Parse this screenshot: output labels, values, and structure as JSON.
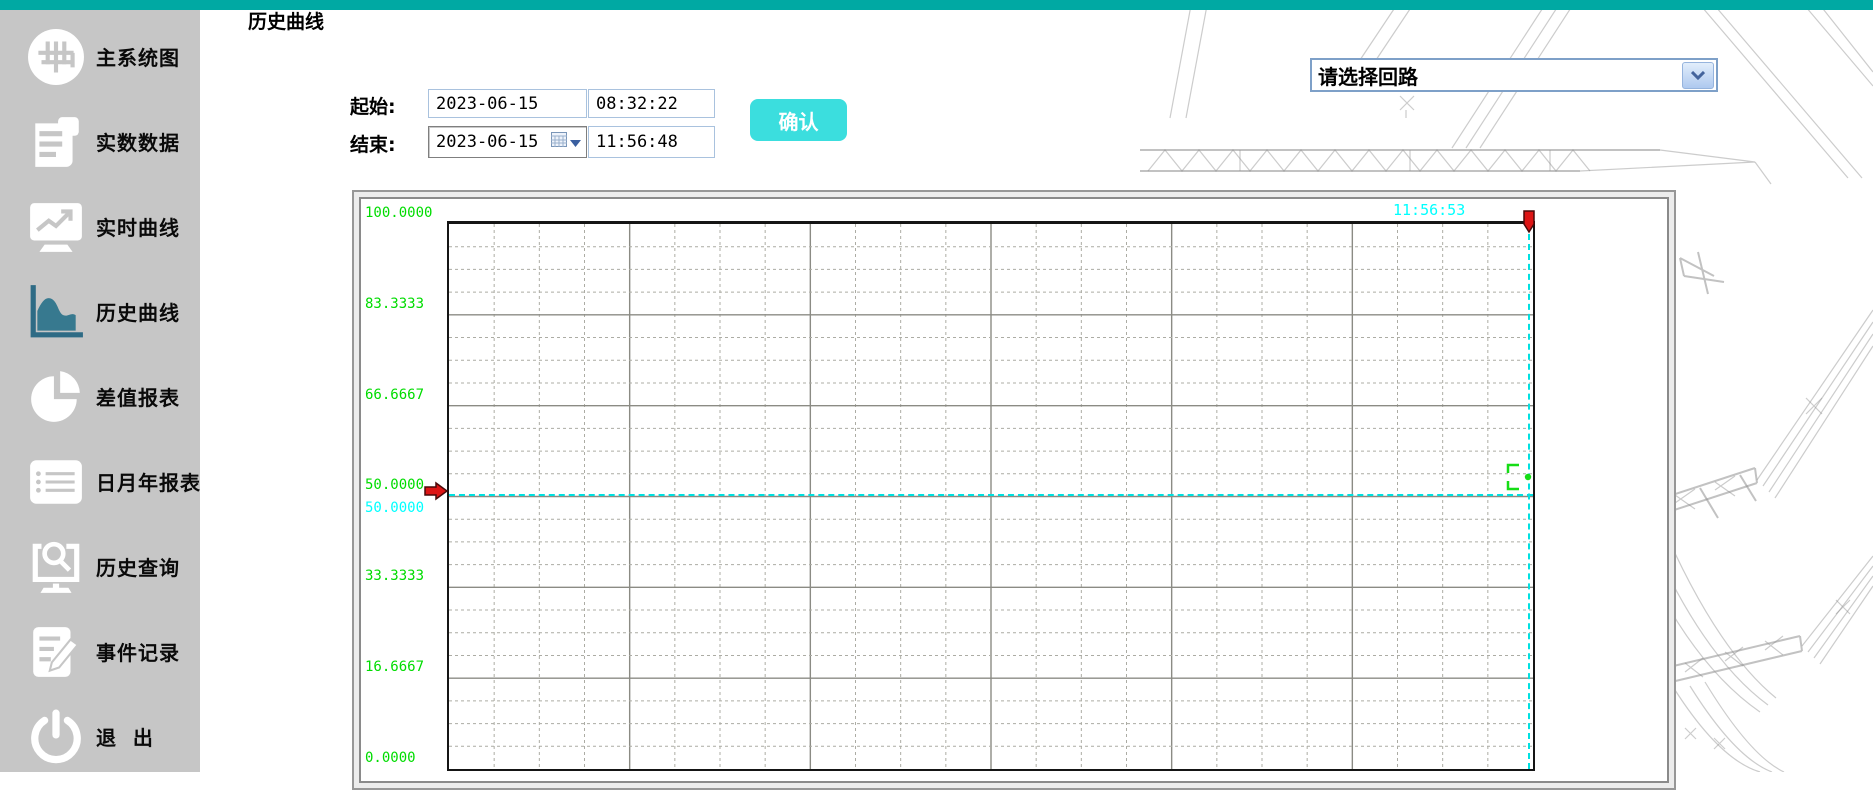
{
  "colors": {
    "accent_teal": "#00A9A3",
    "sidebar_bg": "#C6C6C6",
    "selected_icon_teal": "#37798F",
    "button_cyan": "#3BDEDE",
    "axis_green": "#00DC00",
    "cursor_cyan": "#00E0E0",
    "cyan_text": "#00FFFF",
    "marker_red": "#DD1515",
    "grid_major": "#8B8B84",
    "grid_minor": "#ACACA4",
    "dropdown_border": "#7EA0C8"
  },
  "sidebar": {
    "items": [
      {
        "label": "主系统图",
        "icon": "main-system-icon",
        "selected": false
      },
      {
        "label": "实数数据",
        "icon": "real-data-icon",
        "selected": false
      },
      {
        "label": "实时曲线",
        "icon": "realtime-curve-icon",
        "selected": false
      },
      {
        "label": "历史曲线",
        "icon": "history-curve-icon",
        "selected": true
      },
      {
        "label": "差值报表",
        "icon": "diff-report-icon",
        "selected": false
      },
      {
        "label": "日月年报表",
        "icon": "dmy-report-icon",
        "selected": false
      },
      {
        "label": "历史查询",
        "icon": "history-query-icon",
        "selected": false
      },
      {
        "label": "事件记录",
        "icon": "event-record-icon",
        "selected": false
      },
      {
        "label": "退  出",
        "icon": "exit-icon",
        "selected": false
      }
    ]
  },
  "header": {
    "title": "历史曲线"
  },
  "query": {
    "start_label": "起始:",
    "start_date": "2023-06-15",
    "start_time": "08:32:22",
    "end_label": "结束:",
    "end_date": "2023-06-15",
    "end_time": "11:56:48",
    "confirm_label": "确认"
  },
  "circuit_select": {
    "value": "请选择回路"
  },
  "chart_data": {
    "type": "line",
    "title": "历史曲线",
    "ylim": [
      0,
      100
    ],
    "y_tick_labels": [
      "100.0000",
      "83.3333",
      "66.6667",
      "50.0000",
      "33.3333",
      "16.6667",
      "0.0000"
    ],
    "x_range": {
      "start": "2023-06-15 08:32:22",
      "end": "2023-06-15 11:56:48"
    },
    "grid": {
      "grid_on": true,
      "x_major_divisions": 6,
      "y_major_divisions": 6,
      "x_minor_per_major": 4,
      "y_minor_per_major": 4
    },
    "series": [],
    "cursor": {
      "time_label": "11:56:53",
      "value_label": "50.0000",
      "value": 50.0
    }
  }
}
